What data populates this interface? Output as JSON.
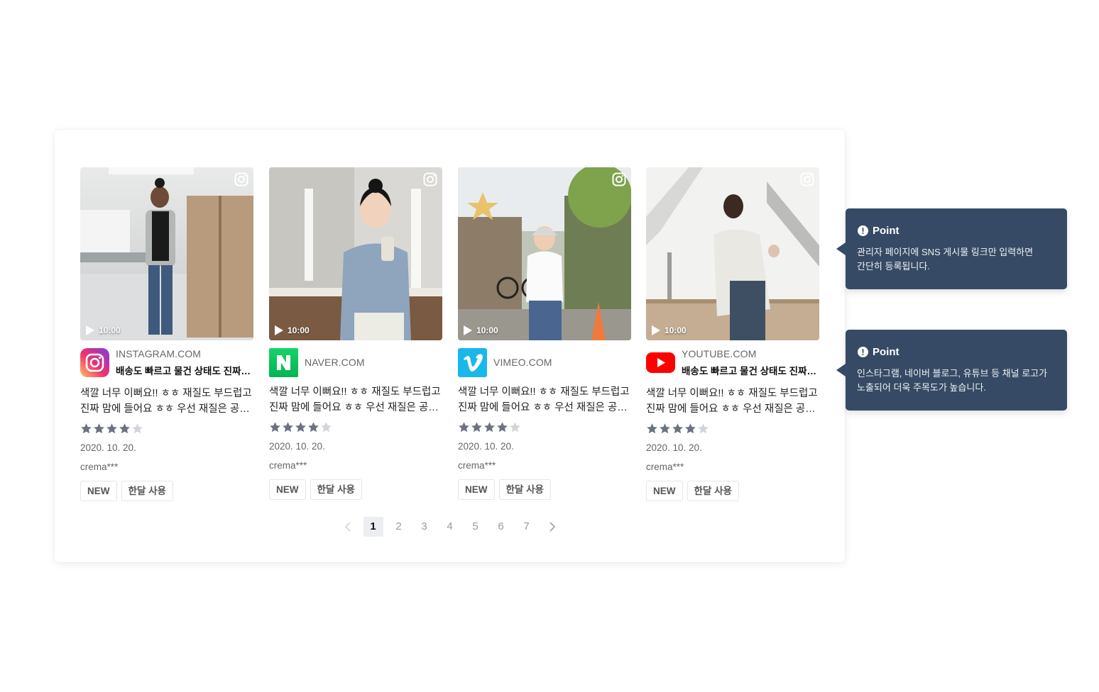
{
  "cards": [
    {
      "source_domain": "INSTAGRAM.COM",
      "source_title": "배송도 빠르고 물건 상태도 진짜 좋아요",
      "source_logo": "instagram-logo",
      "duration": "10:00",
      "body_line1": "색깔 너무 이뻐요!! ㅎㅎ 재질도 부드럽고",
      "body_line2": "진짜 맘에 들어요 ㅎㅎ 우선 재질은 공…",
      "rating": 4,
      "rating_max": 5,
      "date": "2020. 10. 20.",
      "user": "crema***",
      "tags": [
        "NEW",
        "한달 사용"
      ]
    },
    {
      "source_domain": "NAVER.COM",
      "source_title": "",
      "source_logo": "naver-logo",
      "duration": "10:00",
      "body_line1": "색깔 너무 이뻐요!! ㅎㅎ 재질도 부드럽고",
      "body_line2": "진짜 맘에 들어요 ㅎㅎ 우선 재질은 공…",
      "rating": 4,
      "rating_max": 5,
      "date": "2020. 10. 20.",
      "user": "crema***",
      "tags": [
        "NEW",
        "한달 사용"
      ]
    },
    {
      "source_domain": "VIMEO.COM",
      "source_title": "",
      "source_logo": "vimeo-logo",
      "duration": "10:00",
      "body_line1": "색깔 너무 이뻐요!! ㅎㅎ 재질도 부드럽고",
      "body_line2": "진짜 맘에 들어요 ㅎㅎ 우선 재질은 공…",
      "rating": 4,
      "rating_max": 5,
      "date": "2020. 10. 20.",
      "user": "crema***",
      "tags": [
        "NEW",
        "한달 사용"
      ]
    },
    {
      "source_domain": "YOUTUBE.COM",
      "source_title": "배송도 빠르고 물건 상태도 진짜 좋아요",
      "source_logo": "youtube-logo",
      "duration": "10:00",
      "body_line1": "색깔 너무 이뻐요!! ㅎㅎ 재질도 부드럽고",
      "body_line2": "진짜 맘에 들어요 ㅎㅎ 우선 재질은 공…",
      "rating": 4,
      "rating_max": 5,
      "date": "2020. 10. 20.",
      "user": "crema***",
      "tags": [
        "NEW",
        "한달 사용"
      ]
    }
  ],
  "pagination": {
    "pages": [
      "1",
      "2",
      "3",
      "4",
      "5",
      "6",
      "7"
    ],
    "current": "1"
  },
  "tooltips": [
    {
      "title": "Point",
      "line1": "관리자 페이지에 SNS 게시물 링크만 입력하면",
      "line2": "간단히 등록됩니다."
    },
    {
      "title": "Point",
      "line1": "인스타그램, 네이버 블로그, 유튜브 등 채널 로고가",
      "line2": "노출되어 더욱 주목도가 높습니다."
    }
  ],
  "colors": {
    "tooltip_bg": "#364a65",
    "star_filled": "#6b7280",
    "star_empty": "#d1d5db",
    "naver_green": "#03c75a",
    "vimeo_blue": "#1ab7ea",
    "youtube_red": "#ff0000"
  }
}
